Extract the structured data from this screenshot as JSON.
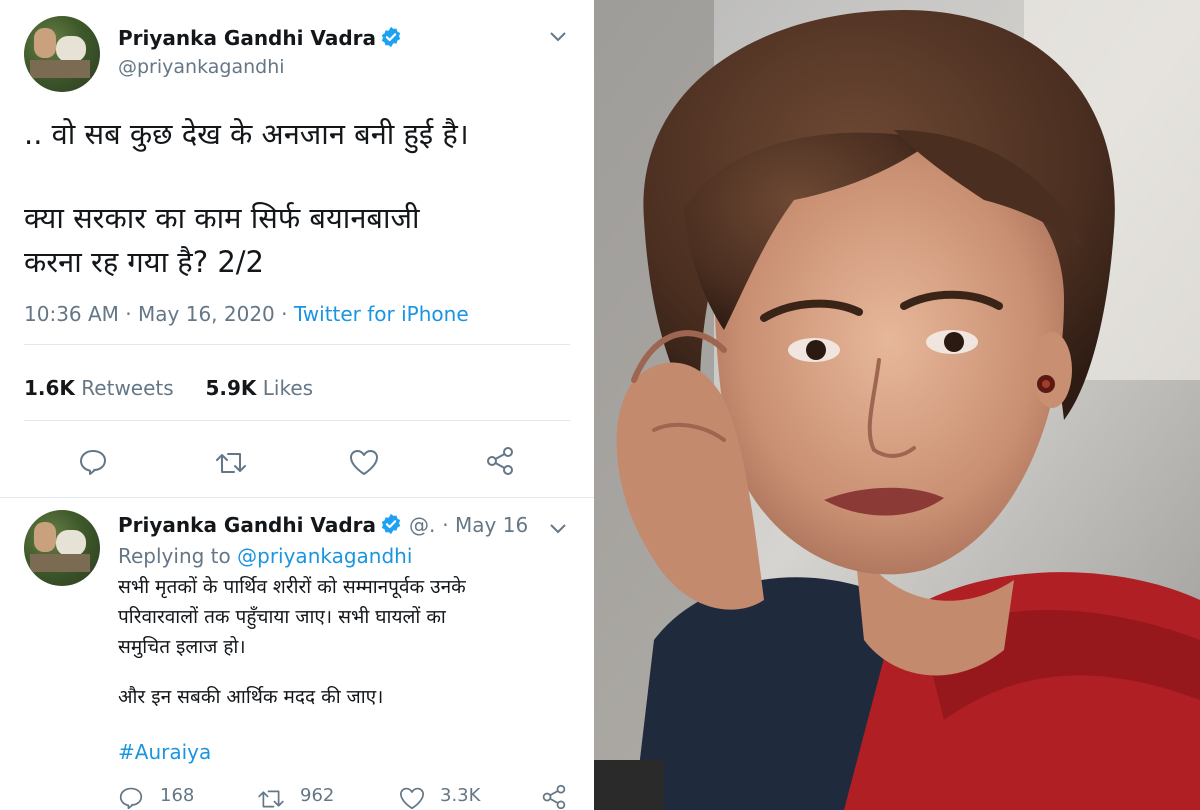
{
  "main_tweet": {
    "author_name": "Priyanka Gandhi Vadra",
    "handle": "@priyankagandhi",
    "text_lines": [
      ".. वो सब कुछ देख के अनजान बनी हुई है।",
      "क्या सरकार का काम सिर्फ बयानबाजी",
      "करना रह गया है? 2/2"
    ],
    "time": "10:36 AM",
    "date": "May 16, 2020",
    "client": "Twitter for iPhone",
    "retweets_count": "1.6K",
    "retweets_label": "Retweets",
    "likes_count": "5.9K",
    "likes_label": "Likes"
  },
  "reply_tweet": {
    "author_name": "Priyanka Gandhi Vadra",
    "handle": "@.",
    "date": "May 16",
    "replying_prefix": "Replying to",
    "replying_to": "@priyankagandhi",
    "text_lines": [
      "सभी मृतकों के पार्थिव शरीरों को सम्मानपूर्वक उनके",
      "परिवारवालों तक पहुँचाया जाए। सभी घायलों का",
      "समुचित इलाज हो।",
      "और इन सबकी आर्थिक मदद की जाए।"
    ],
    "hashtag": "#Auraiya",
    "reply_count": "168",
    "retweet_count": "962",
    "like_count": "3.3K"
  },
  "colors": {
    "link_blue": "#1b95e0",
    "verified_blue": "#1da1f2",
    "secondary_text": "#657786",
    "divider": "#e1e8ed"
  }
}
